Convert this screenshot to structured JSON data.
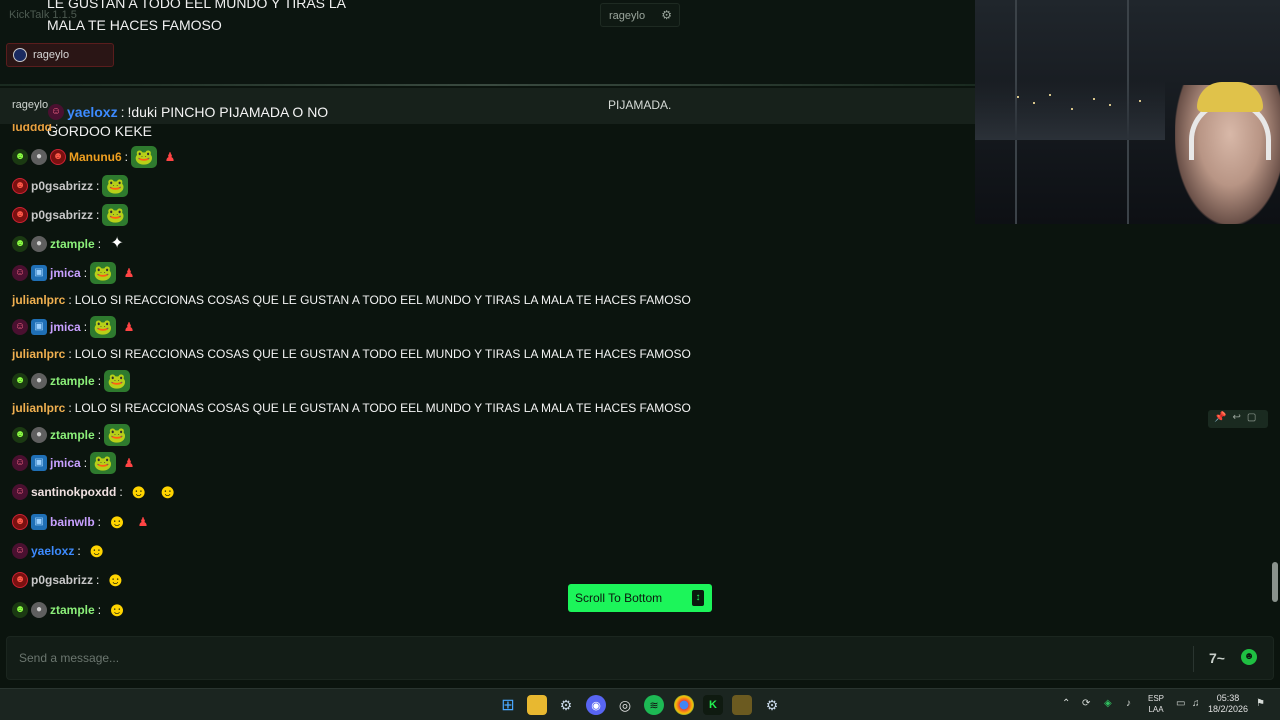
{
  "app": {
    "title": "KickTalk 1.1.5"
  },
  "top_tabs": [
    {
      "label": "rageylo"
    }
  ],
  "search_pill": {
    "label": "rageylo"
  },
  "streamer_tab": {
    "label": "rageylo",
    "pinned_text": "PIJAMADA."
  },
  "overlay_lines": [
    "LE GUSTAN A TODO EEL MUNDO Y TIRAS LA",
    "MALA TE HACES FAMOSO",
    "GORDOO KEKE"
  ],
  "pinned_message": {
    "user": "yaeloxz",
    "user_color": "#3d8bff",
    "text": "!duki PINCHO PIJAMADA O NO"
  },
  "chat": [
    {
      "user": "ztample",
      "user_color": "#8cf07a",
      "badges": [
        "gray",
        "green"
      ],
      "text": "",
      "emotes": [
        "yellow"
      ]
    },
    {
      "user": "ztample",
      "user_color": "#8cf07a",
      "badges": [
        "gray",
        "green"
      ],
      "text": "",
      "emotes": [
        "yellow"
      ]
    },
    {
      "user": "ludddd",
      "user_color": "#e8a040",
      "badges": [],
      "text": "",
      "emotes": []
    },
    {
      "user": "Manunu6",
      "user_color": "#f0a020",
      "badges": [
        "green",
        "gray",
        "red"
      ],
      "text": "",
      "emotes": [
        "pepe",
        "small"
      ]
    },
    {
      "user": "p0gsabrizz",
      "user_color": "#c8c8c8",
      "badges": [
        "red"
      ],
      "text": "",
      "emotes": [
        "pepe"
      ]
    },
    {
      "user": "p0gsabrizz",
      "user_color": "#c8c8c8",
      "badges": [
        "red"
      ],
      "text": "",
      "emotes": [
        "pepe"
      ]
    },
    {
      "user": "ztample",
      "user_color": "#8cf07a",
      "badges": [
        "green",
        "gray"
      ],
      "text": "",
      "emotes": [
        "white"
      ]
    },
    {
      "user": "jmica",
      "user_color": "#c8a0ff",
      "badges": [
        "pink",
        "blue"
      ],
      "text": "",
      "emotes": [
        "pepe",
        "small"
      ]
    },
    {
      "user": "julianlprc",
      "user_color": "#f0b050",
      "badges": [],
      "text": "LOLO SI REACCIONAS COSAS QUE LE GUSTAN A TODO EEL MUNDO Y TIRAS LA MALA TE HACES FAMOSO",
      "emotes": []
    },
    {
      "user": "jmica",
      "user_color": "#c8a0ff",
      "badges": [
        "pink",
        "blue"
      ],
      "text": "",
      "emotes": [
        "pepe",
        "small"
      ]
    },
    {
      "user": "julianlprc",
      "user_color": "#f0b050",
      "badges": [],
      "text": "LOLO SI REACCIONAS COSAS QUE LE GUSTAN A TODO EEL MUNDO Y TIRAS LA MALA TE HACES FAMOSO",
      "emotes": []
    },
    {
      "user": "ztample",
      "user_color": "#8cf07a",
      "badges": [
        "green",
        "gray"
      ],
      "text": "",
      "emotes": [
        "pepe"
      ]
    },
    {
      "user": "julianlprc",
      "user_color": "#f0b050",
      "badges": [],
      "text": "LOLO SI REACCIONAS COSAS QUE LE GUSTAN A TODO EEL MUNDO Y TIRAS LA MALA TE HACES FAMOSO",
      "emotes": []
    },
    {
      "user": "ztample",
      "user_color": "#8cf07a",
      "badges": [
        "green",
        "gray"
      ],
      "text": "",
      "emotes": [
        "pepe"
      ]
    },
    {
      "user": "jmica",
      "user_color": "#c8a0ff",
      "badges": [
        "pink",
        "blue"
      ],
      "text": "",
      "emotes": [
        "pepe",
        "small"
      ]
    },
    {
      "user": "santinokpoxdd",
      "user_color": "#f0e0e0",
      "badges": [
        "pink"
      ],
      "text": "",
      "emotes": [
        "yellow",
        "yellow"
      ]
    },
    {
      "user": "bainwlb",
      "user_color": "#c8a0ff",
      "badges": [
        "red",
        "blue"
      ],
      "text": "",
      "emotes": [
        "yellow",
        "small"
      ]
    },
    {
      "user": "yaeloxz",
      "user_color": "#3d8bff",
      "badges": [
        "pink"
      ],
      "text": "",
      "emotes": [
        "yellow"
      ]
    },
    {
      "user": "p0gsabrizz",
      "user_color": "#c8c8c8",
      "badges": [
        "red"
      ],
      "text": "",
      "emotes": [
        "yellow"
      ]
    },
    {
      "user": "ztample",
      "user_color": "#8cf07a",
      "badges": [
        "green",
        "gray"
      ],
      "text": "",
      "emotes": [
        "yellow"
      ]
    }
  ],
  "scroll_button": {
    "label": "Scroll To Bottom"
  },
  "input": {
    "placeholder": "Send a message..."
  },
  "taskbar": {
    "lang_top": "ESP",
    "lang_bottom": "LAA",
    "time": "05:38",
    "date": "18/2/2026"
  }
}
